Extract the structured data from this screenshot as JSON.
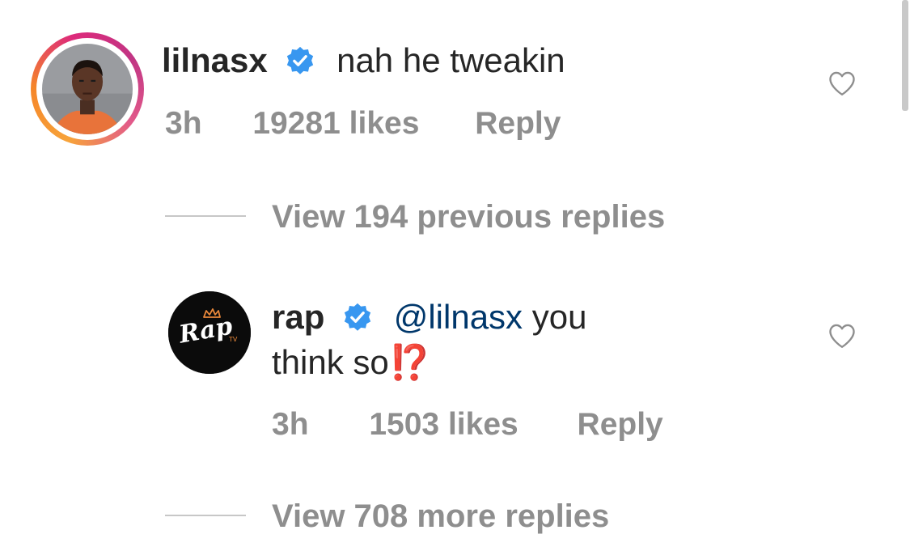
{
  "comment": {
    "username": "lilnasx",
    "text": "nah he tweakin",
    "time": "3h",
    "likes": "19281 likes",
    "reply_label": "Reply",
    "view_replies": "View 194 previous replies"
  },
  "reply": {
    "username": "rap",
    "mention": "@lilnasx",
    "text_part1": "you",
    "text_part2": "think so",
    "emoji": "⁉️",
    "time": "3h",
    "likes": "1503 likes",
    "reply_label": "Reply",
    "view_replies": "View 708 more replies",
    "avatar_logo_text": "Rap"
  },
  "colors": {
    "verified_blue": "#3897f0",
    "meta_gray": "#8e8e8e",
    "mention_blue": "#00376b",
    "emoji_red": "#e0245e"
  },
  "icons": {
    "verified": "verified-badge-icon",
    "heart": "heart-outline-icon"
  }
}
